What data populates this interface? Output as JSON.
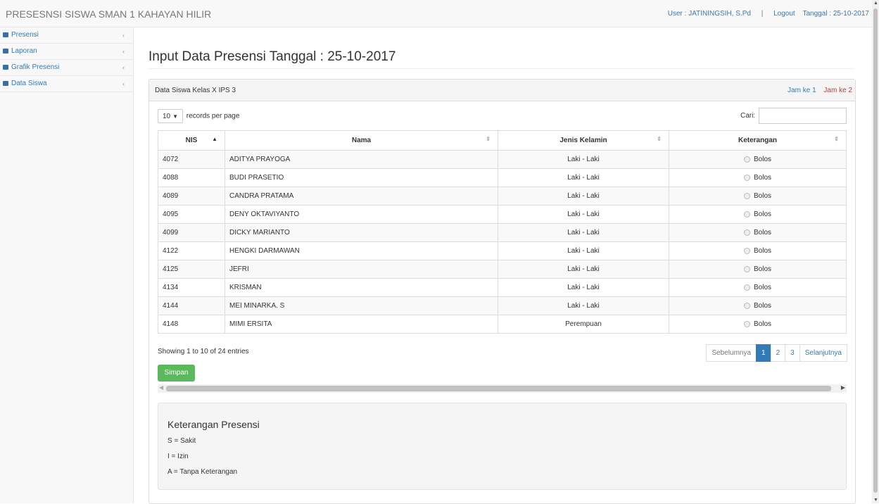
{
  "header": {
    "app_title": "PRESESNSI SISWA SMAN 1 KAHAYAN HILIR",
    "user": "User : JATININGSIH, S.Pd",
    "separator": "|",
    "logout": "Logout",
    "date": "Tanggal : 25-10-2017"
  },
  "sidebar": {
    "items": [
      {
        "label": "Presensi",
        "icon": "book-icon"
      },
      {
        "label": "Laporan",
        "icon": "chart-icon"
      },
      {
        "label": "Grafik Presensi",
        "icon": "chart-icon"
      },
      {
        "label": "Data Siswa",
        "icon": "users-icon"
      }
    ],
    "chevron": "‹"
  },
  "main": {
    "title": "Input Data Presensi Tanggal : 25-10-2017",
    "panel_title": "Data Siswa Kelas X IPS 3",
    "jam_ke_1": "Jam ke 1",
    "jam_ke_2": "Jam ke 2"
  },
  "table_controls": {
    "length_value": "10",
    "length_label": "records per page",
    "search_label": "Cari:",
    "search_value": ""
  },
  "table": {
    "columns": [
      "NIS",
      "Nama",
      "Jenis Kelamin",
      "Keterangan"
    ],
    "radio_label": "Bolos",
    "rows": [
      {
        "nis": "4072",
        "nama": "ADITYA PRAYOGA",
        "jk": "Laki - Laki"
      },
      {
        "nis": "4088",
        "nama": "BUDI PRASETIO",
        "jk": "Laki - Laki"
      },
      {
        "nis": "4089",
        "nama": "CANDRA PRATAMA",
        "jk": "Laki - Laki"
      },
      {
        "nis": "4095",
        "nama": "DENY OKTAVIYANTO",
        "jk": "Laki - Laki"
      },
      {
        "nis": "4099",
        "nama": "DICKY MARIANTO",
        "jk": "Laki - Laki"
      },
      {
        "nis": "4122",
        "nama": "HENGKI DARMAWAN",
        "jk": "Laki - Laki"
      },
      {
        "nis": "4125",
        "nama": "JEFRI",
        "jk": "Laki - Laki"
      },
      {
        "nis": "4134",
        "nama": "KRISMAN",
        "jk": "Laki - Laki"
      },
      {
        "nis": "4144",
        "nama": "MEI MINARKA. S",
        "jk": "Laki - Laki"
      },
      {
        "nis": "4148",
        "nama": "MIMI ERSITA",
        "jk": "Perempuan"
      }
    ]
  },
  "footer": {
    "info": "Showing 1 to 10 of 24 entries",
    "prev": "Sebelumnya",
    "pages": [
      "1",
      "2",
      "3"
    ],
    "next": "Selanjutnya",
    "save": "Simpan"
  },
  "legend": {
    "title": "Keterangan Presensi",
    "lines": [
      "S = Sakit",
      "I = Izin",
      "A = Tanpa Keterangan"
    ]
  },
  "colors": {
    "link": "#337ab7",
    "danger": "#a94442",
    "success": "#5cb85c"
  }
}
